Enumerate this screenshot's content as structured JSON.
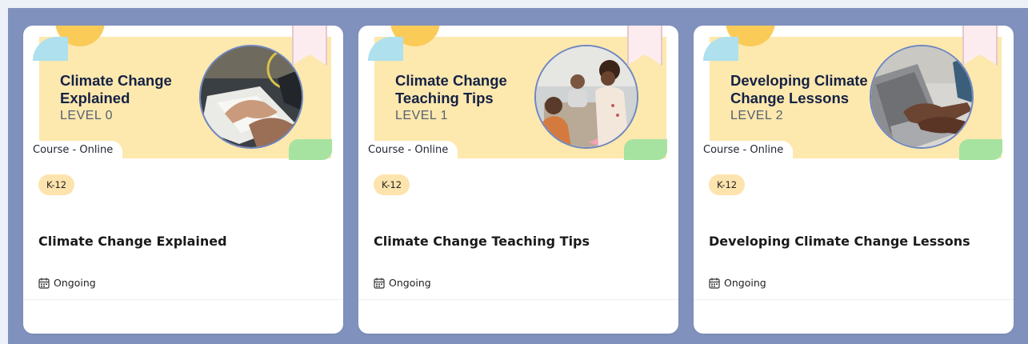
{
  "courses": [
    {
      "banner_title": "Climate Change Explained",
      "banner_level": "LEVEL 0",
      "course_type": "Course - Online",
      "grade_badge": "K-12",
      "title": "Climate Change Explained",
      "status": "Ongoing",
      "photo": "hands-writing-notebook-photo"
    },
    {
      "banner_title": "Climate Change Teaching Tips",
      "banner_level": "LEVEL 1",
      "course_type": "Course - Online",
      "grade_badge": "K-12",
      "title": "Climate Change Teaching Tips",
      "status": "Ongoing",
      "photo": "teacher-with-students-photo"
    },
    {
      "banner_title": "Developing Climate Change Lessons",
      "banner_level": "LEVEL 2",
      "course_type": "Course - Online",
      "grade_badge": "K-12",
      "title": "Developing Climate Change Lessons",
      "status": "Ongoing",
      "photo": "hands-typing-laptop-photo"
    }
  ],
  "icons": {
    "status": "calendar-icon",
    "bookmark": "bookmark-ribbon-icon"
  },
  "colors": {
    "page_background": "#8191bd",
    "banner_background": "#fde8ae",
    "badge_background": "#fde3ad",
    "accent_yellow": "#fbcb58",
    "accent_blue": "#aee0ee",
    "accent_green": "#a6e3a0",
    "title_text": "#152245"
  }
}
